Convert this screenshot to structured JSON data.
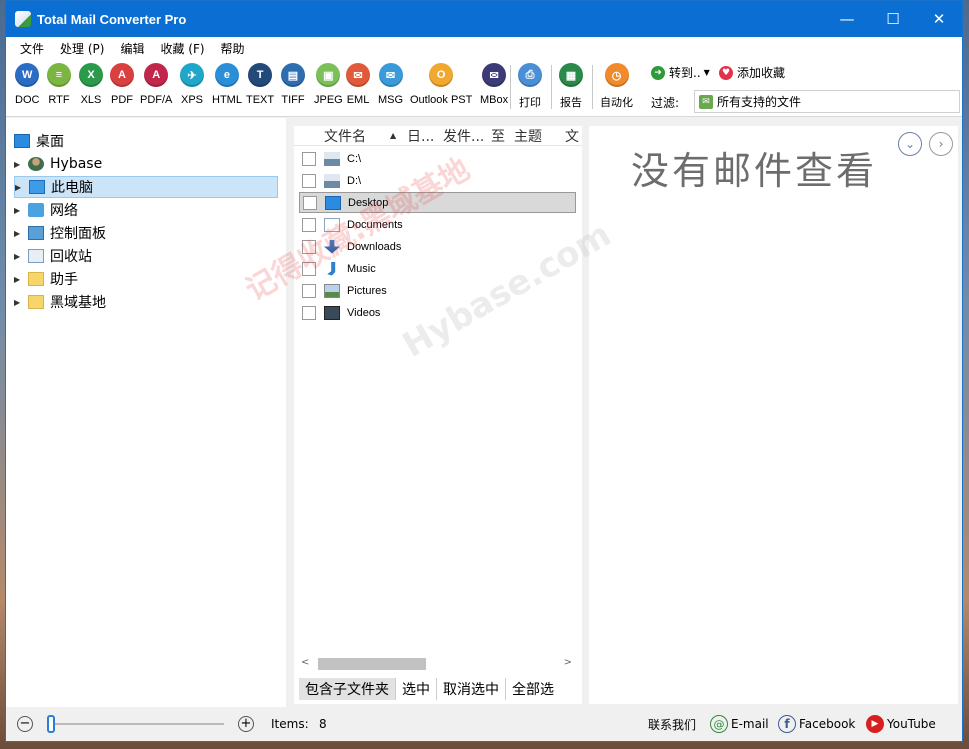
{
  "window": {
    "title": "Total Mail Converter Pro",
    "controls": {
      "minimize": "—",
      "maximize": "☐",
      "close": "✕"
    }
  },
  "menu": [
    "文件",
    "处理 (P)",
    "编辑",
    "收藏 (F)",
    "帮助"
  ],
  "toolbar": {
    "buttons": [
      {
        "label": "DOC",
        "glyph": "W",
        "color": "#2b6cc4"
      },
      {
        "label": "RTF",
        "glyph": "≡",
        "color": "#7bb542"
      },
      {
        "label": "XLS",
        "glyph": "X",
        "color": "#2c9a4b"
      },
      {
        "label": "PDF",
        "glyph": "A",
        "color": "#d94040"
      },
      {
        "label": "PDF/A",
        "glyph": "A",
        "color": "#c0274a"
      },
      {
        "label": "XPS",
        "glyph": "✈",
        "color": "#20a6c9"
      },
      {
        "label": "HTML",
        "glyph": "e",
        "color": "#2a8fd6"
      },
      {
        "label": "TEXT",
        "glyph": "T",
        "color": "#234a7a"
      },
      {
        "label": "TIFF",
        "glyph": "▤",
        "color": "#2e6db0"
      },
      {
        "label": "JPEG",
        "glyph": "▣",
        "color": "#7cc05a"
      },
      {
        "label": "EML",
        "glyph": "✉",
        "color": "#e05b3c"
      },
      {
        "label": "MSG",
        "glyph": "✉",
        "color": "#3b9ad9"
      },
      {
        "label": "Outlook PST",
        "glyph": "O",
        "color": "#f0a830"
      },
      {
        "label": "MBox",
        "glyph": "✉",
        "color": "#3d3a78"
      },
      {
        "label": "打印",
        "glyph": "⎙",
        "color": "#4a8fd6"
      },
      {
        "label": "报告",
        "glyph": "▦",
        "color": "#2a8a4a"
      },
      {
        "label": "自动化",
        "glyph": "◷",
        "color": "#f08a2a"
      }
    ],
    "goto_label": "转到..",
    "favorite_label": "添加收藏",
    "filter_label": "过滤:",
    "filter_value": "所有支持的文件"
  },
  "tree": {
    "items": [
      {
        "label": "桌面",
        "icon": "desktop-icon",
        "expandable": false,
        "selected": false
      },
      {
        "label": "Hybase",
        "icon": "user-icon",
        "expandable": true,
        "selected": false
      },
      {
        "label": "此电脑",
        "icon": "computer-icon",
        "expandable": true,
        "selected": true
      },
      {
        "label": "网络",
        "icon": "network-icon",
        "expandable": true,
        "selected": false
      },
      {
        "label": "控制面板",
        "icon": "control-panel-icon",
        "expandable": true,
        "selected": false
      },
      {
        "label": "回收站",
        "icon": "recycle-bin-icon",
        "expandable": true,
        "selected": false
      },
      {
        "label": "助手",
        "icon": "folder-icon",
        "expandable": true,
        "selected": false
      },
      {
        "label": "黑域基地",
        "icon": "folder-icon",
        "expandable": true,
        "selected": false
      }
    ]
  },
  "files": {
    "columns": [
      "文件名",
      "日...",
      "发件...",
      "至",
      "主题",
      "文"
    ],
    "rows": [
      {
        "name": "C:\\",
        "icon": "drive-icon",
        "selected": false
      },
      {
        "name": "D:\\",
        "icon": "drive-icon",
        "selected": false
      },
      {
        "name": "Desktop",
        "icon": "desktop-icon",
        "selected": true
      },
      {
        "name": "Documents",
        "icon": "documents-icon",
        "selected": false
      },
      {
        "name": "Downloads",
        "icon": "download-icon",
        "selected": false
      },
      {
        "name": "Music",
        "icon": "music-icon",
        "selected": false
      },
      {
        "name": "Pictures",
        "icon": "pictures-icon",
        "selected": false
      },
      {
        "name": "Videos",
        "icon": "videos-icon",
        "selected": false
      }
    ],
    "tabs": [
      "包含子文件夹",
      "选中",
      "取消选中",
      "全部选"
    ]
  },
  "viewer": {
    "empty_text": "没有邮件查看"
  },
  "watermark": {
    "line1": "记得收藏:黑域基地",
    "line2": "Hybase.com"
  },
  "status": {
    "items_label": "Items:",
    "items_count": "8",
    "zoom_level": 0,
    "contact_label": "联系我们",
    "email_label": "E-mail",
    "facebook_label": "Facebook",
    "youtube_label": "YouTube"
  }
}
